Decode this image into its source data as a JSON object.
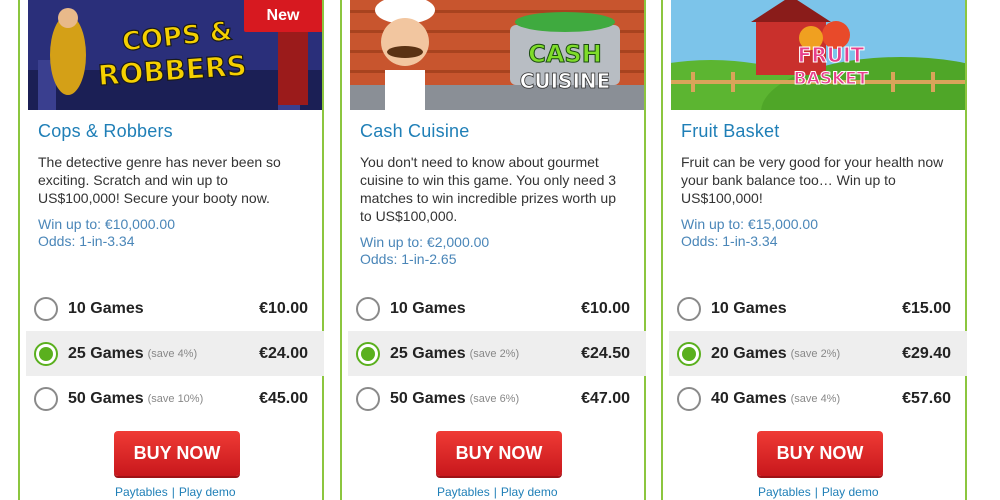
{
  "cards": [
    {
      "title": "Cops & Robbers",
      "banner_text": "COPS & ROBBERS",
      "badge": "New",
      "description": "The detective genre has never been so exciting. Scratch and win up to US$100,000! Secure your booty now.",
      "win": "Win up to: €10,000.00",
      "odds": "Odds: 1-in-3.34",
      "options": [
        {
          "label": "10 Games",
          "save": "",
          "price": "€10.00",
          "selected": false
        },
        {
          "label": "25 Games",
          "save": "(save 4%)",
          "price": "€24.00",
          "selected": true
        },
        {
          "label": "50 Games",
          "save": "(save 10%)",
          "price": "€45.00",
          "selected": false
        }
      ],
      "buy_label": "BUY NOW",
      "link_paytables": "Paytables",
      "link_demo": "Play demo"
    },
    {
      "title": "Cash Cuisine",
      "banner_text": "CASH CUISINE",
      "description": "You don't need to know about gourmet cuisine to win this game. You only need 3 matches to win incredible prizes worth up to US$100,000.",
      "win": "Win up to: €2,000.00",
      "odds": "Odds: 1-in-2.65",
      "options": [
        {
          "label": "10 Games",
          "save": "",
          "price": "€10.00",
          "selected": false
        },
        {
          "label": "25 Games",
          "save": "(save 2%)",
          "price": "€24.50",
          "selected": true
        },
        {
          "label": "50 Games",
          "save": "(save 6%)",
          "price": "€47.00",
          "selected": false
        }
      ],
      "buy_label": "BUY NOW",
      "link_paytables": "Paytables",
      "link_demo": "Play demo"
    },
    {
      "title": "Fruit Basket",
      "banner_text": "FRUIT BASKET",
      "description": "Fruit can be very good for your health now your bank balance too… Win up to US$100,000!",
      "win": "Win up to: €15,000.00",
      "odds": "Odds: 1-in-3.34",
      "options": [
        {
          "label": "10 Games",
          "save": "",
          "price": "€15.00",
          "selected": false
        },
        {
          "label": "20 Games",
          "save": "(save 2%)",
          "price": "€29.40",
          "selected": true
        },
        {
          "label": "40 Games",
          "save": "(save 4%)",
          "price": "€57.60",
          "selected": false
        }
      ],
      "buy_label": "BUY NOW",
      "link_paytables": "Paytables",
      "link_demo": "Play demo"
    }
  ],
  "colors": {
    "border": "#8cc63f",
    "title": "#1f7fb7",
    "radio_selected": "#5ab01e",
    "buy_button": "#d7252a",
    "new_badge": "#d71920"
  }
}
